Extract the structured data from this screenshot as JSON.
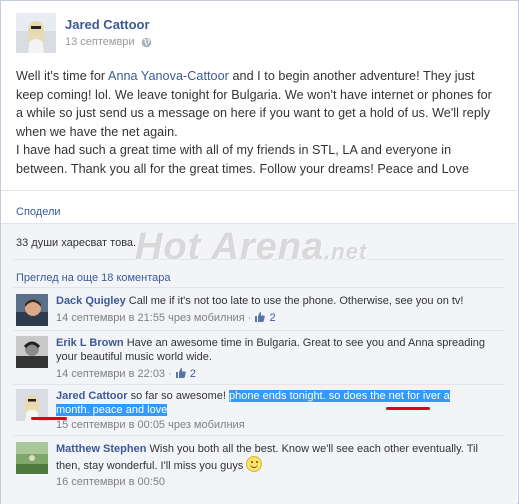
{
  "post": {
    "author": "Jared Cattoor",
    "date": "13 септември",
    "text_part1": "Well it's time for ",
    "mention": "Anna Yanova-Cattoor",
    "text_part2": " and I to begin another adventure! They just keep coming! lol. We leave tonight for Bulgaria. We won't have internet or phones for a while so just send us a message on here if you want to get a hold of us. We'll reply when we have the net again.",
    "text_paragraph2": "I have had such a great time with all of my friends in STL, LA and everyone in between. Thank you all for the great times. Follow your dreams! Peace and Love",
    "avatar_icon": "profile-photo-icon",
    "privacy_icon": "globe-icon"
  },
  "actions": {
    "share": "Сподели"
  },
  "feedback": {
    "likes": "33 души харесват това.",
    "more_comments": "Преглед на още 18 коментара"
  },
  "comments": [
    {
      "author": "Dack Quigley",
      "text": "Call me if it's not too late to use the phone. Otherwise, see you on tv!",
      "time": "14 септември в 21:55 чрез мобилния",
      "likes": "2"
    },
    {
      "author": "Erik L Brown",
      "text": "Have an awesome time in Bulgaria. Great to see you and Anna spreading your beautiful music world wide.",
      "time": "14 септември в 22:03",
      "likes": "2"
    },
    {
      "author": "Jared Cattoor",
      "text_plain": "so far so awesome! ",
      "text_highlight_1": "phone ends tonight. so does the net for iver a",
      "text_highlight_2": "month. peace and love",
      "time": "15 септември в 00:05 чрез мобилния"
    },
    {
      "author": "Matthew Stephen",
      "text": "Wish you both all the best. Know we'll see each other eventually. Til then, stay wonderful. I'll miss you guys ",
      "time": "16 септември в 00:50"
    }
  ],
  "watermark": {
    "text": "Hot Arena",
    "tld": ".net"
  },
  "meta_separator": "·",
  "colors": {
    "link": "#3b5998",
    "highlight": "#3399ff",
    "red_underline": "#e2001a",
    "feedback_bg": "#f2f4f8"
  }
}
